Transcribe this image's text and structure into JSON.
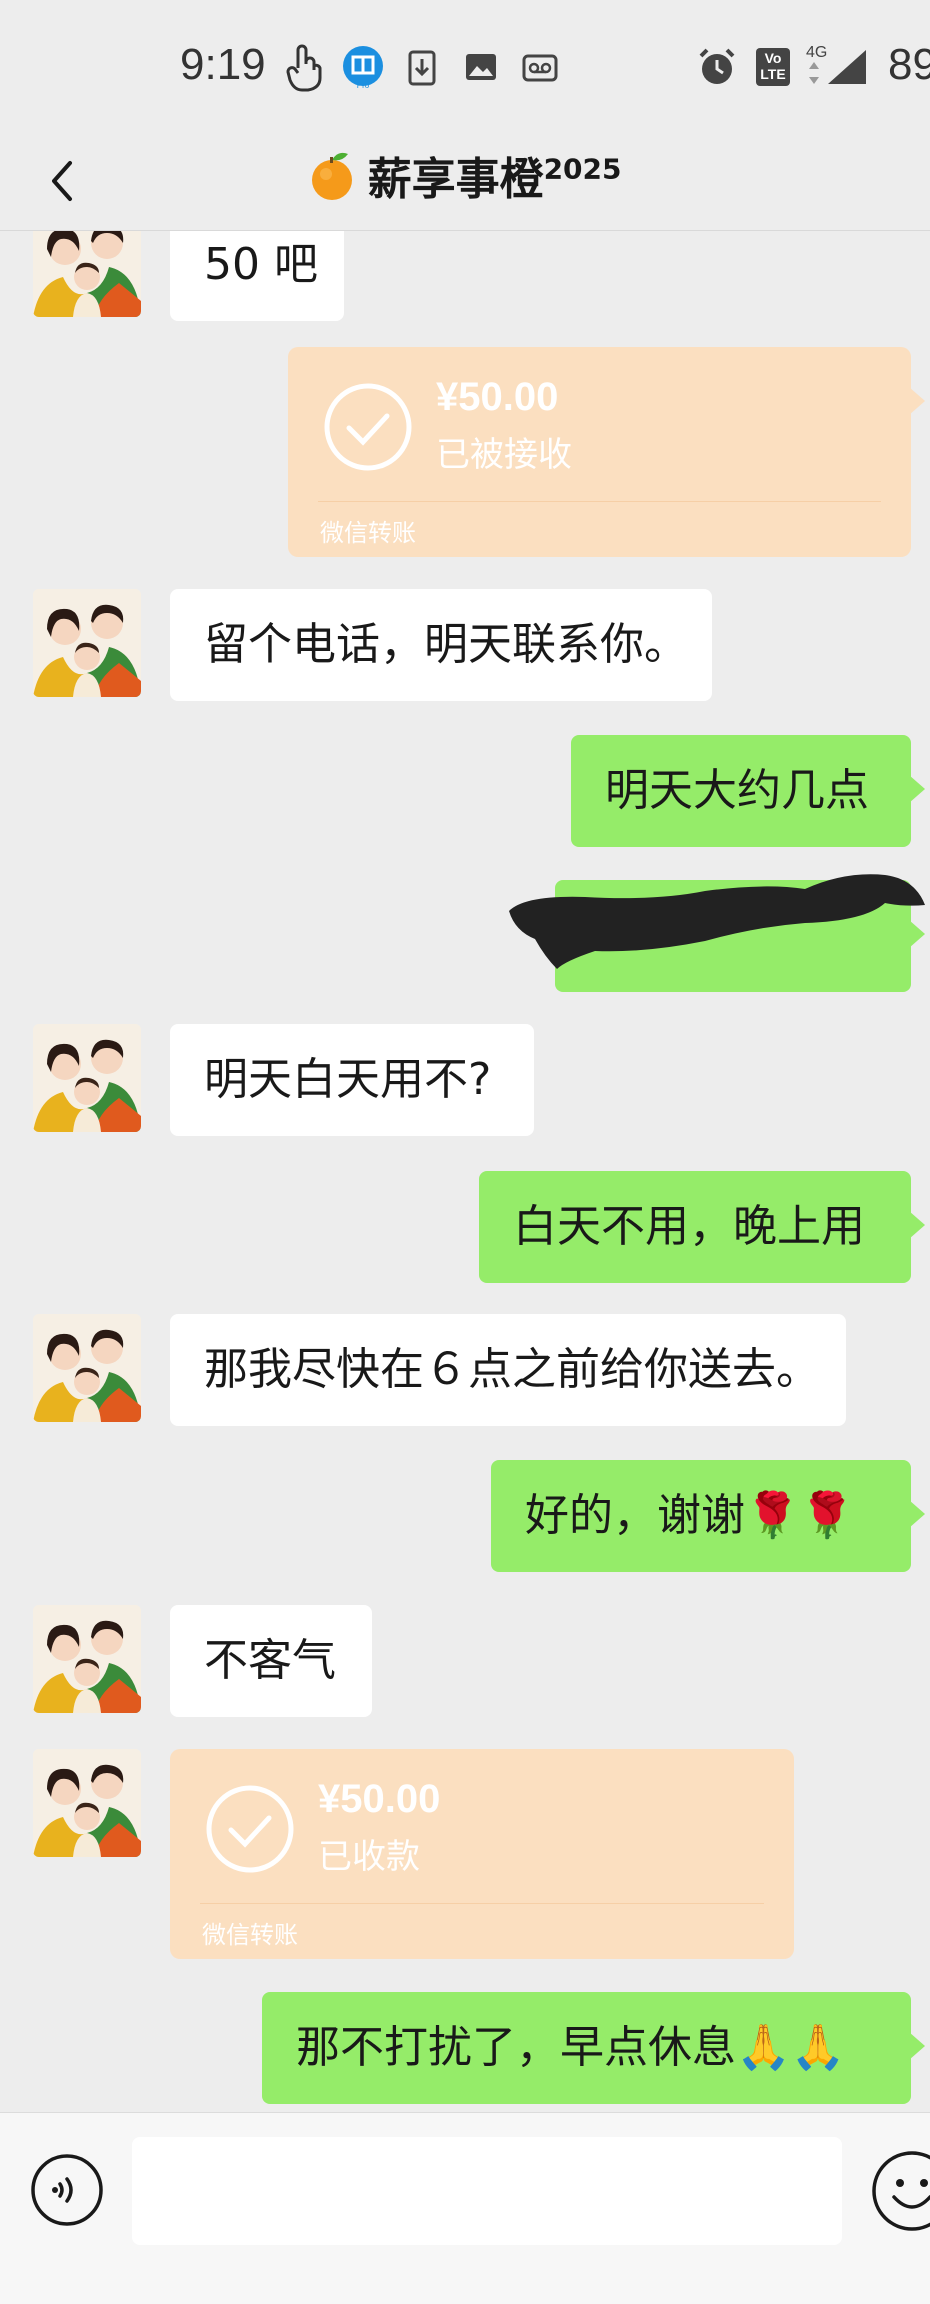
{
  "status_bar": {
    "time": "9:19",
    "network": "4G",
    "lte_badge": "LTE",
    "battery": "89",
    "icons": [
      "hand-pointer-icon",
      "app-pro-icon",
      "download-icon",
      "image-icon",
      "voicemail-icon",
      "alarm-icon",
      "volte-icon",
      "signal-icon"
    ]
  },
  "header": {
    "back_icon": "chevron-left-icon",
    "emoji": "🍊",
    "title": "薪享事橙",
    "title_suffix": "2025"
  },
  "messages": [
    {
      "side": "in",
      "type": "text",
      "text": "50 吧"
    },
    {
      "side": "out",
      "type": "transfer",
      "amount": "¥50.00",
      "status": "已被接收",
      "label": "微信转账"
    },
    {
      "side": "in",
      "type": "text",
      "text": "留个电话，明天联系你。"
    },
    {
      "side": "out",
      "type": "text",
      "text": "明天大约几点"
    },
    {
      "side": "out",
      "type": "redacted",
      "text": ""
    },
    {
      "side": "in",
      "type": "text",
      "text": "明天白天用不?"
    },
    {
      "side": "out",
      "type": "text",
      "text": "白天不用，晚上用"
    },
    {
      "side": "in",
      "type": "text",
      "text": "那我尽快在６点之前给你送去。"
    },
    {
      "side": "out",
      "type": "text",
      "text": "好的，谢谢🌹🌹"
    },
    {
      "side": "in",
      "type": "text",
      "text": "不客气"
    },
    {
      "side": "in",
      "type": "transfer",
      "amount": "¥50.00",
      "status": "已收款",
      "label": "微信转账"
    },
    {
      "side": "out",
      "type": "text",
      "text": "那不打扰了，早点休息🙏🙏"
    }
  ],
  "input_bar": {
    "voice_icon": "voice-icon",
    "placeholder": "",
    "emoji_icon": "emoji-icon"
  },
  "colors": {
    "background": "#ededed",
    "incoming_bubble": "#ffffff",
    "outgoing_bubble": "#95ec69",
    "transfer_card": "#fbdfc0"
  }
}
